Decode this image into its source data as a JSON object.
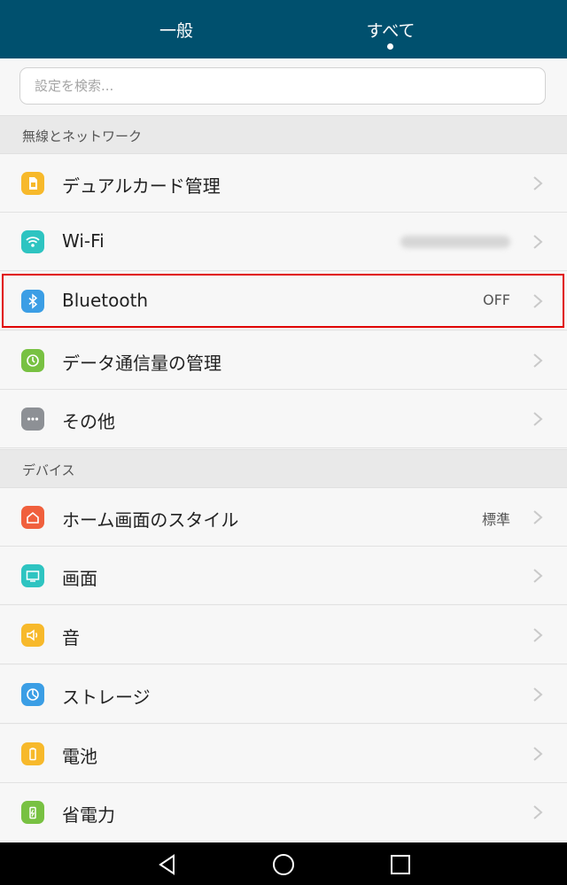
{
  "tabs": {
    "general": "一般",
    "all": "すべて"
  },
  "search": {
    "placeholder": "設定を検索..."
  },
  "sections": {
    "wireless": "無線とネットワーク",
    "device": "デバイス"
  },
  "rows": {
    "dual_card": {
      "label": "デュアルカード管理",
      "icon": "sim-card-icon",
      "color": "#f7b92b"
    },
    "wifi": {
      "label": "Wi-Fi",
      "icon": "wifi-icon",
      "color": "#2ec4c1"
    },
    "bluetooth": {
      "label": "Bluetooth",
      "value": "OFF",
      "icon": "bluetooth-icon",
      "color": "#3b9ee5"
    },
    "data_usage": {
      "label": "データ通信量の管理",
      "icon": "data-usage-icon",
      "color": "#78c142"
    },
    "more": {
      "label": "その他",
      "icon": "more-icon",
      "color": "#8d9095"
    },
    "home_style": {
      "label": "ホーム画面のスタイル",
      "value": "標準",
      "icon": "home-icon",
      "color": "#f0603d"
    },
    "display": {
      "label": "画面",
      "icon": "display-icon",
      "color": "#2ec4c1"
    },
    "sound": {
      "label": "音",
      "icon": "sound-icon",
      "color": "#f7b92b"
    },
    "storage": {
      "label": "ストレージ",
      "icon": "storage-icon",
      "color": "#3b9ee5"
    },
    "battery": {
      "label": "電池",
      "icon": "battery-icon",
      "color": "#f7b92b"
    },
    "power_saving": {
      "label": "省電力",
      "icon": "power-saving-icon",
      "color": "#78c142"
    }
  },
  "colors": {
    "header": "#00506e",
    "highlight": "#e00000"
  }
}
